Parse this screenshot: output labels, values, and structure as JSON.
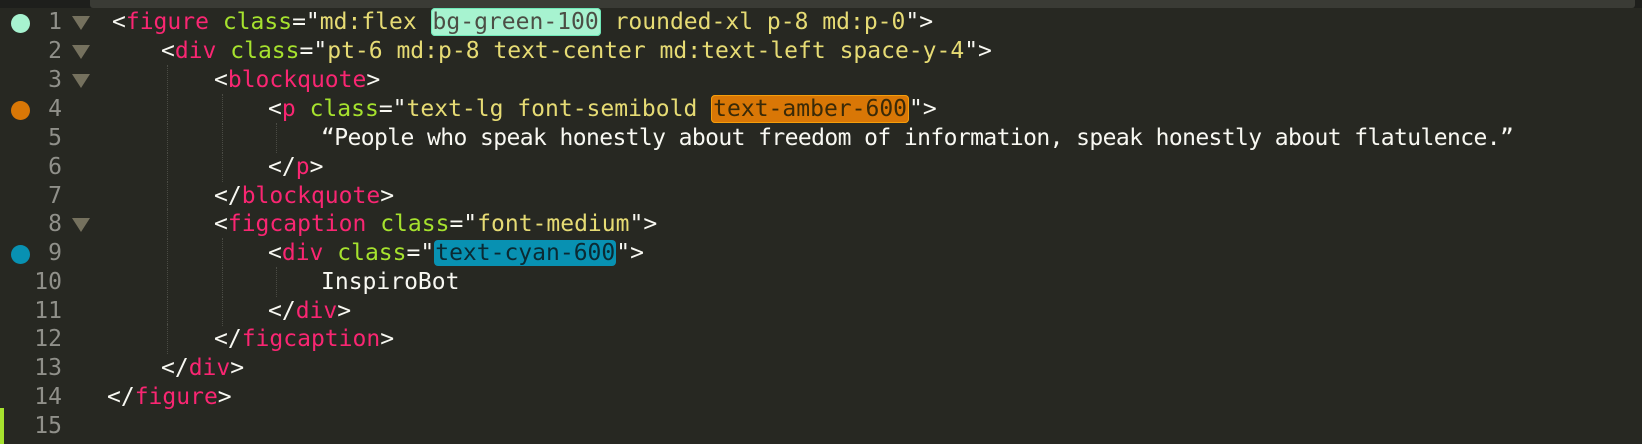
{
  "colors": {
    "background": "#272822",
    "tag": "#f92672",
    "attribute": "#a6e22e",
    "string": "#e6db74",
    "punctuation": "#f8f8f2",
    "green_100": "#a7f3d0",
    "amber_600": "#d97706",
    "cyan_600": "#0891b2"
  },
  "lines": [
    {
      "number": "1",
      "marker": "green-100",
      "foldable": true
    },
    {
      "number": "2",
      "foldable": true
    },
    {
      "number": "3",
      "foldable": true
    },
    {
      "number": "4",
      "marker": "amber-600"
    },
    {
      "number": "5"
    },
    {
      "number": "6"
    },
    {
      "number": "7"
    },
    {
      "number": "8",
      "foldable": true
    },
    {
      "number": "9",
      "marker": "cyan-600"
    },
    {
      "number": "10"
    },
    {
      "number": "11"
    },
    {
      "number": "12"
    },
    {
      "number": "13"
    },
    {
      "number": "14"
    },
    {
      "number": "15"
    }
  ],
  "tokens": {
    "lt": "<",
    "gt": ">",
    "close_lt": "</",
    "eq_quote": "=\"",
    "quote": "\"",
    "quote_gt": "\">",
    "attr_class": "class",
    "tag_figure": "figure",
    "tag_div": "div",
    "tag_blockquote": "blockquote",
    "tag_p": "p",
    "tag_figcaption": "figcaption",
    "l1_class_a": "md:flex ",
    "l1_class_hl": "bg-green-100",
    "l1_class_b": " rounded-xl p-8 md:p-0",
    "l2_class": "pt-6 md:p-8 text-center md:text-left space-y-4",
    "l4_class_a": "text-lg font-semibold ",
    "l4_class_hl": "text-amber-600",
    "l5_text": "“People who speak honestly about freedom of information, speak honestly about flatulence.”",
    "l8_class": "font-medium",
    "l9_class_hl": "text-cyan-600",
    "l10_text": "InspiroBot"
  }
}
